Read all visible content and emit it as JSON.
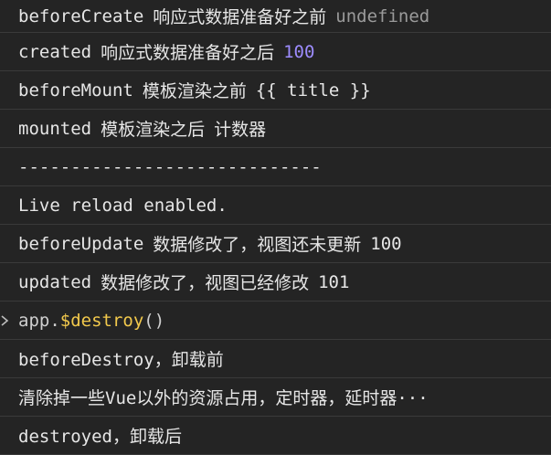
{
  "console": {
    "lines": [
      {
        "parts": [
          "beforeCreate",
          "响应式数据准备好之前",
          "undefined"
        ]
      },
      {
        "parts": [
          "created",
          "响应式数据准备好之后",
          "100"
        ]
      },
      {
        "parts": [
          "beforeMount",
          "模板渲染之前",
          "{{ title }}"
        ]
      },
      {
        "parts": [
          "mounted",
          "模板渲染之后",
          "计数器"
        ]
      },
      {
        "parts": [
          "-----------------------------"
        ]
      },
      {
        "parts": [
          "Live reload enabled."
        ]
      },
      {
        "parts": [
          "beforeUpdate",
          "数据修改了，视图还未更新",
          "100"
        ]
      },
      {
        "parts": [
          "updated",
          "数据修改了，视图已经修改",
          "101"
        ]
      },
      {
        "parts": [
          "app.",
          "$destroy",
          "()"
        ]
      },
      {
        "parts": [
          "beforeDestroy，卸载前"
        ]
      },
      {
        "parts": [
          "清除掉一些Vue以外的资源占用，定时器，延时器···"
        ]
      },
      {
        "parts": [
          "destroyed，卸载后"
        ]
      }
    ]
  },
  "icons": {
    "prompt": "chevron-right-icon"
  },
  "colors": {
    "background": "#242424",
    "text": "#e6e6e6",
    "muted": "#9a9a9a",
    "number": "#9d8cff",
    "function": "#f2c94c"
  }
}
